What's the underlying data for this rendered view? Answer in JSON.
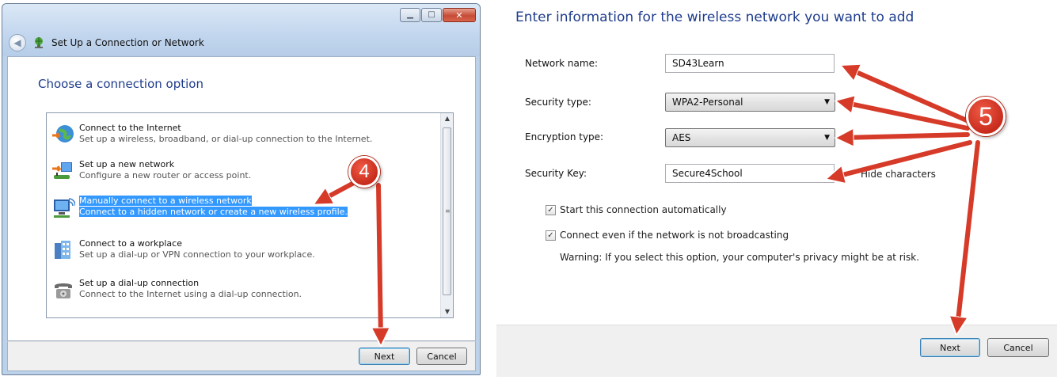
{
  "left_window": {
    "title": "Set Up a Connection or Network",
    "heading": "Choose a connection option",
    "caption_buttons": [
      "minimize",
      "maximize",
      "close"
    ],
    "options": [
      {
        "title": "Connect to the Internet",
        "desc": "Set up a wireless, broadband, or dial-up connection to the Internet.",
        "icon": "globe-network-icon",
        "selected": false
      },
      {
        "title": "Set up a new network",
        "desc": "Configure a new router or access point.",
        "icon": "router-icon",
        "selected": false
      },
      {
        "title": "Manually connect to a wireless network",
        "desc": "Connect to a hidden network or create a new wireless profile.",
        "icon": "wireless-computer-icon",
        "selected": true
      },
      {
        "title": "Connect to a workplace",
        "desc": "Set up a dial-up or VPN connection to your workplace.",
        "icon": "workplace-building-icon",
        "selected": false
      },
      {
        "title": "Set up a dial-up connection",
        "desc": "Connect to the Internet using a dial-up connection.",
        "icon": "telephone-icon",
        "selected": false
      }
    ],
    "buttons": {
      "next": "Next",
      "cancel": "Cancel"
    },
    "callout_number": "4"
  },
  "right_window": {
    "heading": "Enter information for the wireless network you want to add",
    "network_name": {
      "label": "Network name:",
      "value": "SD43Learn"
    },
    "security_type": {
      "label": "Security type:",
      "value": "WPA2-Personal"
    },
    "encryption_type": {
      "label": "Encryption type:",
      "value": "AES"
    },
    "security_key": {
      "label": "Security Key:",
      "value": "Secure4School",
      "hide_label": "Hide characters"
    },
    "start_auto": {
      "label": "Start this connection automatically",
      "checked": true
    },
    "connect_not_broadcasting": {
      "label": "Connect even if the network is not broadcasting",
      "checked": true
    },
    "warning": "Warning: If you select this option, your computer's privacy might be at risk.",
    "buttons": {
      "next": "Next",
      "cancel": "Cancel"
    },
    "callout_number": "5"
  },
  "colors": {
    "heading_blue": "#1e3c8c",
    "selection_blue": "#3399ff",
    "annotation_red": "#d63a28"
  }
}
